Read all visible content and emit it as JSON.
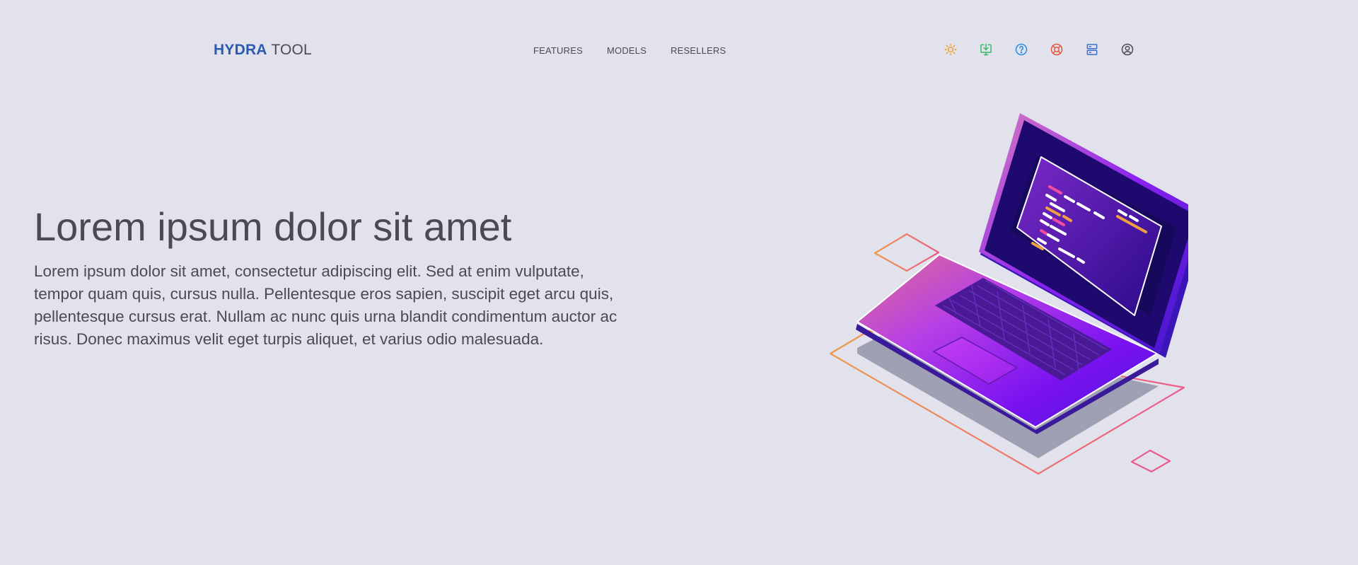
{
  "header": {
    "logo_brand": "HYDRA",
    "logo_rest": "TOOL",
    "nav": [
      "FEATURES",
      "MODELS",
      "RESELLERS"
    ],
    "icons": [
      {
        "name": "sun-icon",
        "color": "#f0a030"
      },
      {
        "name": "download-icon",
        "color": "#3bb86a"
      },
      {
        "name": "help-circle-icon",
        "color": "#2a8de0"
      },
      {
        "name": "lifebuoy-icon",
        "color": "#e2553a"
      },
      {
        "name": "server-icon",
        "color": "#3f6fc4"
      },
      {
        "name": "user-circle-icon",
        "color": "#4a4a52"
      }
    ]
  },
  "hero": {
    "title": "Lorem ipsum dolor sit amet",
    "text": "Lorem ipsum dolor sit amet, consectetur adipiscing elit. Sed at enim vulputate, tempor quam quis, cursus nulla. Pellentesque eros sapien, suscipit eget arcu quis, pellentesque cursus erat. Nullam ac nunc quis urna blandit condimentum auctor ac risus. Donec maximus velit eget turpis aliquet, et varius odio malesuada."
  },
  "colors": {
    "background": "#e2e2ec",
    "brand": "#2a5bb0",
    "text": "#4a4a52"
  },
  "illustration": {
    "name": "laptop-illustration"
  }
}
